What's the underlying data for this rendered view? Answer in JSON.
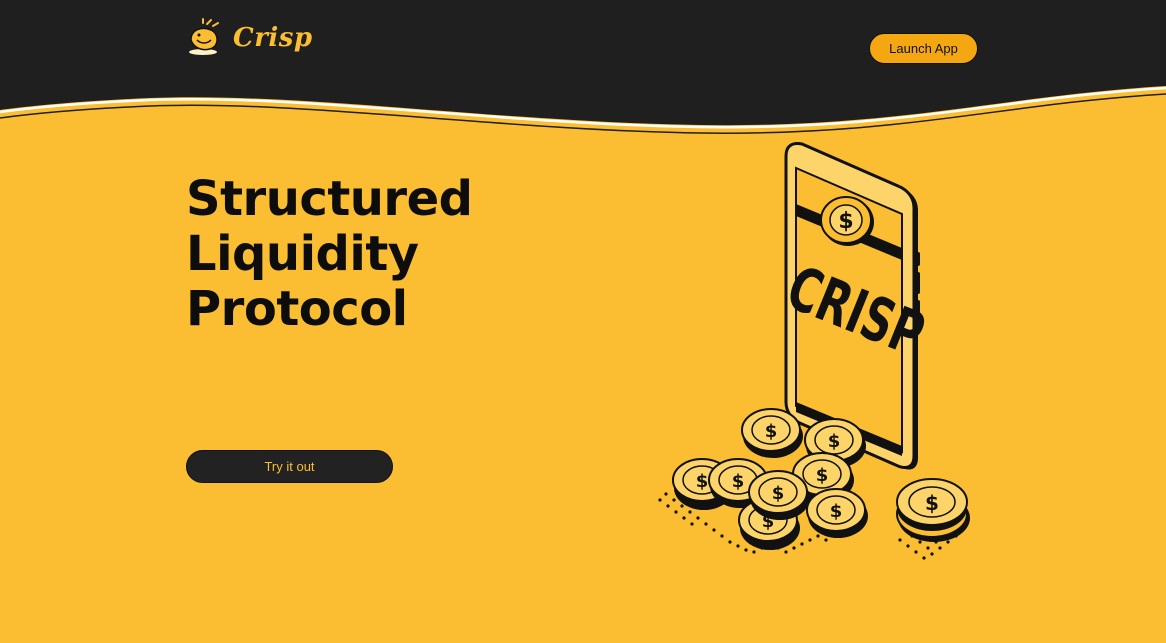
{
  "header": {
    "brand_name": "Crisp",
    "launch_label": "Launch App"
  },
  "hero": {
    "headline": [
      "Structured",
      "Liquidity",
      "Protocol"
    ],
    "cta_label": "Try it out"
  },
  "illustration": {
    "phone_text": "CRISP",
    "coin_symbol": "$"
  },
  "colors": {
    "brand_yellow": "#fbbd31",
    "header_dark": "#1f1f1f",
    "button_orange": "#f5a712",
    "ink": "#0d0d0d"
  },
  "icons": {
    "logo": "crisp-chip-logo-icon"
  }
}
